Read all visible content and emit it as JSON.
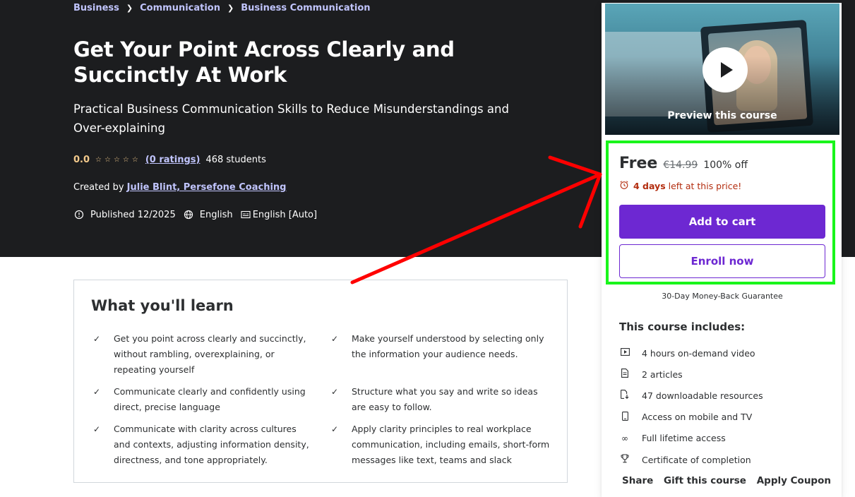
{
  "breadcrumb": [
    "Business",
    "Communication",
    "Business Communication"
  ],
  "course": {
    "title": "Get Your Point Across Clearly and Succinctly At Work",
    "subtitle": "Practical Business Communication Skills to Reduce Misunderstandings and Over-explaining",
    "rating": "0.0",
    "ratings_link": "(0 ratings)",
    "students": "468 students",
    "created_prefix": "Created by",
    "authors": "Julie Blint, Persefone Coaching",
    "published": "Published 12/2025",
    "language": "English",
    "captions": "English [Auto]"
  },
  "learn": {
    "title": "What you'll learn",
    "items": [
      "Get you point across clearly and succinctly, without rambling, overexplaining, or repeating yourself",
      "Make yourself understood by selecting only the information your audience needs.",
      "Communicate clearly and confidently using direct, precise language",
      "Structure what you say and write so ideas are easy to follow.",
      "Communicate with clarity across cultures and contexts, adjusting information density, directness, and tone appropriately.",
      "Apply clarity principles to real workplace communication, including emails, short-form messages like text, teams and slack"
    ]
  },
  "sidebar": {
    "preview_label": "Preview this course",
    "price": "Free",
    "original_price": "€14.99",
    "discount": "100% off",
    "timer_bold": "4 days",
    "timer_rest": "left at this price!",
    "add_to_cart": "Add to cart",
    "enroll_now": "Enroll now",
    "guarantee": "30-Day Money-Back Guarantee",
    "includes_title": "This course includes:",
    "includes": [
      {
        "icon": "video-icon",
        "label": "4 hours on-demand video"
      },
      {
        "icon": "article-icon",
        "label": "2 articles"
      },
      {
        "icon": "download-icon",
        "label": "47 downloadable resources"
      },
      {
        "icon": "mobile-icon",
        "label": "Access on mobile and TV"
      },
      {
        "icon": "infinity-icon",
        "label": "Full lifetime access"
      },
      {
        "icon": "trophy-icon",
        "label": "Certificate of completion"
      }
    ],
    "actions": [
      "Share",
      "Gift this course",
      "Apply Coupon"
    ]
  },
  "colors": {
    "hero_bg": "#1c1d1f",
    "accent_purple": "#6d28d2",
    "link_purple": "#c0c4fc",
    "star_gold": "#f3ca8c",
    "timer_red": "#b32d0f",
    "highlight_green": "#19f51b",
    "annotation_arrow": "#ff0000"
  }
}
